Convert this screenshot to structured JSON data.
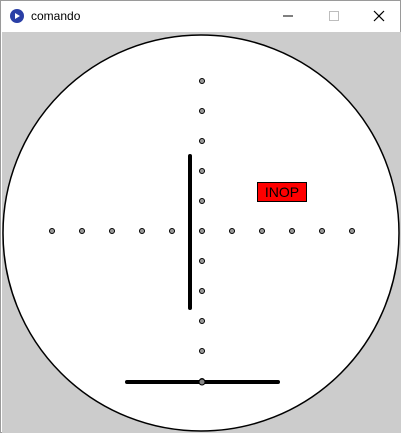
{
  "window": {
    "title": "comando",
    "app_icon": "app-icon"
  },
  "controls": {
    "minimize_icon": "minimize-icon",
    "maximize_icon": "maximize-icon",
    "close_icon": "close-icon"
  },
  "scope": {
    "background_color": "#cccccc",
    "face_color": "#ffffff",
    "status_label": "INOP",
    "status_color": "#ff0000"
  }
}
